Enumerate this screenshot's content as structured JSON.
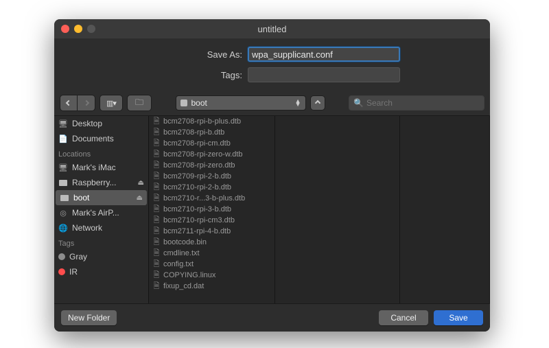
{
  "window": {
    "title": "untitled"
  },
  "save_as": {
    "label": "Save As:",
    "value": "wpa_supplicant.conf"
  },
  "tags": {
    "label": "Tags:"
  },
  "location": {
    "current": "boot"
  },
  "search": {
    "placeholder": "Search"
  },
  "sidebar": {
    "fav_top": [
      {
        "label": "Desktop",
        "icon": "🖥"
      },
      {
        "label": "Documents",
        "icon": "📄"
      }
    ],
    "locations_hdr": "Locations",
    "locations": [
      {
        "label": "Mark's iMac",
        "icon": "🖥",
        "eject": false
      },
      {
        "label": "Raspberry...",
        "icon": "disk",
        "eject": true
      },
      {
        "label": "boot",
        "icon": "disk",
        "eject": true,
        "selected": true
      },
      {
        "label": "Mark's AirP...",
        "icon": "◎",
        "eject": false
      },
      {
        "label": "Network",
        "icon": "🌐",
        "eject": false
      }
    ],
    "tags_hdr": "Tags",
    "tags": [
      {
        "label": "Gray",
        "color": "#8e8e8e"
      },
      {
        "label": "IR",
        "color": "#ff4d4d"
      }
    ]
  },
  "files": [
    "bcm2708-rpi-b-plus.dtb",
    "bcm2708-rpi-b.dtb",
    "bcm2708-rpi-cm.dtb",
    "bcm2708-rpi-zero-w.dtb",
    "bcm2708-rpi-zero.dtb",
    "bcm2709-rpi-2-b.dtb",
    "bcm2710-rpi-2-b.dtb",
    "bcm2710-r...3-b-plus.dtb",
    "bcm2710-rpi-3-b.dtb",
    "bcm2710-rpi-cm3.dtb",
    "bcm2711-rpi-4-b.dtb",
    "bootcode.bin",
    "cmdline.txt",
    "config.txt",
    "COPYING.linux",
    "fixup_cd.dat"
  ],
  "footer": {
    "new_folder": "New Folder",
    "cancel": "Cancel",
    "save": "Save"
  }
}
